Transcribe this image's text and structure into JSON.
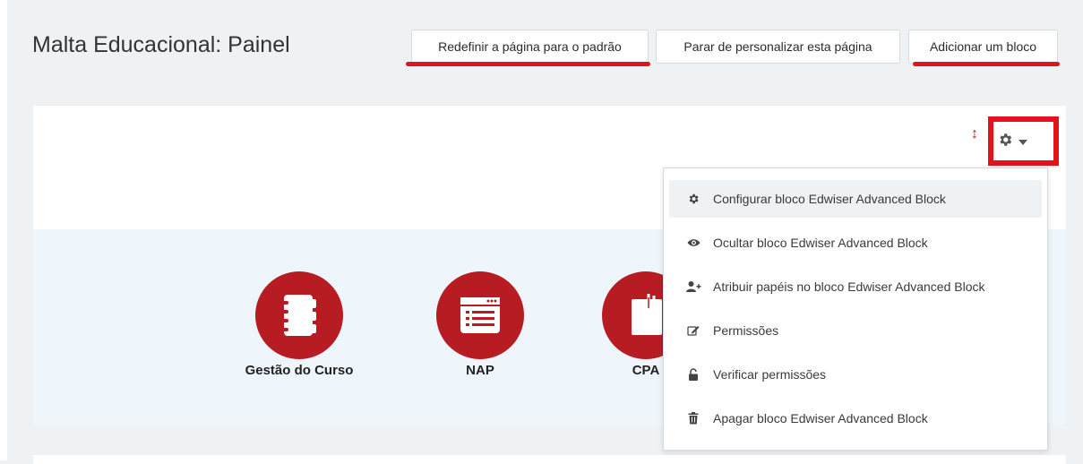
{
  "page": {
    "title": "Malta Educacional: Painel"
  },
  "header_buttons": {
    "reset": "Redefinir a página para o padrão",
    "stop_customizing": "Parar de personalizar esta página",
    "add_block": "Adicionar um bloco"
  },
  "block": {
    "tiles": [
      {
        "label": "Gestão do Curso",
        "icon": "notebook-icon"
      },
      {
        "label": "NAP",
        "icon": "browser-list-icon"
      },
      {
        "label": "CPA",
        "icon": "clipboard-icon"
      }
    ]
  },
  "dropdown": {
    "items": [
      {
        "label": "Configurar bloco Edwiser Advanced Block",
        "icon": "gear-icon"
      },
      {
        "label": "Ocultar bloco Edwiser Advanced Block",
        "icon": "eye-icon"
      },
      {
        "label": "Atribuir papéis no bloco Edwiser Advanced Block",
        "icon": "user-plus-icon"
      },
      {
        "label": "Permissões",
        "icon": "edit-icon"
      },
      {
        "label": "Verificar permissões",
        "icon": "unlock-icon"
      },
      {
        "label": "Apagar bloco Edwiser Advanced Block",
        "icon": "trash-icon"
      }
    ]
  },
  "colors": {
    "highlight_red": "#e3131b",
    "tile_red": "#b71c23"
  }
}
